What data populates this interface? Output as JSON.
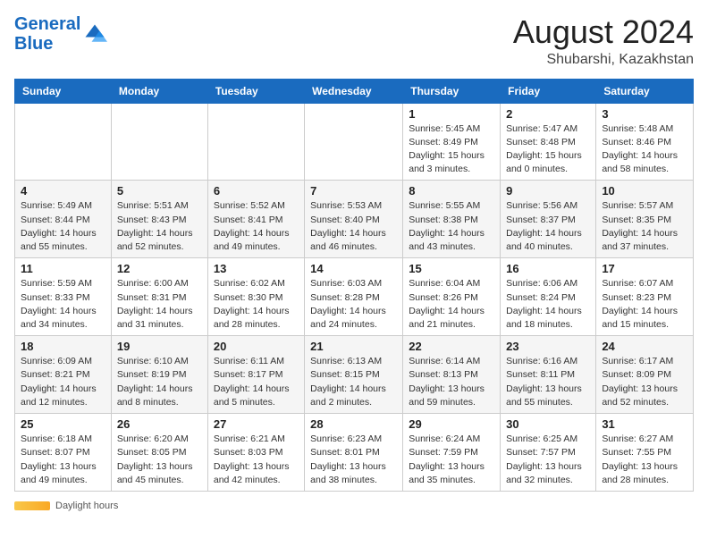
{
  "header": {
    "logo_line1": "General",
    "logo_line2": "Blue",
    "month": "August 2024",
    "location": "Shubarshi, Kazakhstan"
  },
  "days_of_week": [
    "Sunday",
    "Monday",
    "Tuesday",
    "Wednesday",
    "Thursday",
    "Friday",
    "Saturday"
  ],
  "weeks": [
    [
      {
        "day": "",
        "info": ""
      },
      {
        "day": "",
        "info": ""
      },
      {
        "day": "",
        "info": ""
      },
      {
        "day": "",
        "info": ""
      },
      {
        "day": "1",
        "info": "Sunrise: 5:45 AM\nSunset: 8:49 PM\nDaylight: 15 hours\nand 3 minutes."
      },
      {
        "day": "2",
        "info": "Sunrise: 5:47 AM\nSunset: 8:48 PM\nDaylight: 15 hours\nand 0 minutes."
      },
      {
        "day": "3",
        "info": "Sunrise: 5:48 AM\nSunset: 8:46 PM\nDaylight: 14 hours\nand 58 minutes."
      }
    ],
    [
      {
        "day": "4",
        "info": "Sunrise: 5:49 AM\nSunset: 8:44 PM\nDaylight: 14 hours\nand 55 minutes."
      },
      {
        "day": "5",
        "info": "Sunrise: 5:51 AM\nSunset: 8:43 PM\nDaylight: 14 hours\nand 52 minutes."
      },
      {
        "day": "6",
        "info": "Sunrise: 5:52 AM\nSunset: 8:41 PM\nDaylight: 14 hours\nand 49 minutes."
      },
      {
        "day": "7",
        "info": "Sunrise: 5:53 AM\nSunset: 8:40 PM\nDaylight: 14 hours\nand 46 minutes."
      },
      {
        "day": "8",
        "info": "Sunrise: 5:55 AM\nSunset: 8:38 PM\nDaylight: 14 hours\nand 43 minutes."
      },
      {
        "day": "9",
        "info": "Sunrise: 5:56 AM\nSunset: 8:37 PM\nDaylight: 14 hours\nand 40 minutes."
      },
      {
        "day": "10",
        "info": "Sunrise: 5:57 AM\nSunset: 8:35 PM\nDaylight: 14 hours\nand 37 minutes."
      }
    ],
    [
      {
        "day": "11",
        "info": "Sunrise: 5:59 AM\nSunset: 8:33 PM\nDaylight: 14 hours\nand 34 minutes."
      },
      {
        "day": "12",
        "info": "Sunrise: 6:00 AM\nSunset: 8:31 PM\nDaylight: 14 hours\nand 31 minutes."
      },
      {
        "day": "13",
        "info": "Sunrise: 6:02 AM\nSunset: 8:30 PM\nDaylight: 14 hours\nand 28 minutes."
      },
      {
        "day": "14",
        "info": "Sunrise: 6:03 AM\nSunset: 8:28 PM\nDaylight: 14 hours\nand 24 minutes."
      },
      {
        "day": "15",
        "info": "Sunrise: 6:04 AM\nSunset: 8:26 PM\nDaylight: 14 hours\nand 21 minutes."
      },
      {
        "day": "16",
        "info": "Sunrise: 6:06 AM\nSunset: 8:24 PM\nDaylight: 14 hours\nand 18 minutes."
      },
      {
        "day": "17",
        "info": "Sunrise: 6:07 AM\nSunset: 8:23 PM\nDaylight: 14 hours\nand 15 minutes."
      }
    ],
    [
      {
        "day": "18",
        "info": "Sunrise: 6:09 AM\nSunset: 8:21 PM\nDaylight: 14 hours\nand 12 minutes."
      },
      {
        "day": "19",
        "info": "Sunrise: 6:10 AM\nSunset: 8:19 PM\nDaylight: 14 hours\nand 8 minutes."
      },
      {
        "day": "20",
        "info": "Sunrise: 6:11 AM\nSunset: 8:17 PM\nDaylight: 14 hours\nand 5 minutes."
      },
      {
        "day": "21",
        "info": "Sunrise: 6:13 AM\nSunset: 8:15 PM\nDaylight: 14 hours\nand 2 minutes."
      },
      {
        "day": "22",
        "info": "Sunrise: 6:14 AM\nSunset: 8:13 PM\nDaylight: 13 hours\nand 59 minutes."
      },
      {
        "day": "23",
        "info": "Sunrise: 6:16 AM\nSunset: 8:11 PM\nDaylight: 13 hours\nand 55 minutes."
      },
      {
        "day": "24",
        "info": "Sunrise: 6:17 AM\nSunset: 8:09 PM\nDaylight: 13 hours\nand 52 minutes."
      }
    ],
    [
      {
        "day": "25",
        "info": "Sunrise: 6:18 AM\nSunset: 8:07 PM\nDaylight: 13 hours\nand 49 minutes."
      },
      {
        "day": "26",
        "info": "Sunrise: 6:20 AM\nSunset: 8:05 PM\nDaylight: 13 hours\nand 45 minutes."
      },
      {
        "day": "27",
        "info": "Sunrise: 6:21 AM\nSunset: 8:03 PM\nDaylight: 13 hours\nand 42 minutes."
      },
      {
        "day": "28",
        "info": "Sunrise: 6:23 AM\nSunset: 8:01 PM\nDaylight: 13 hours\nand 38 minutes."
      },
      {
        "day": "29",
        "info": "Sunrise: 6:24 AM\nSunset: 7:59 PM\nDaylight: 13 hours\nand 35 minutes."
      },
      {
        "day": "30",
        "info": "Sunrise: 6:25 AM\nSunset: 7:57 PM\nDaylight: 13 hours\nand 32 minutes."
      },
      {
        "day": "31",
        "info": "Sunrise: 6:27 AM\nSunset: 7:55 PM\nDaylight: 13 hours\nand 28 minutes."
      }
    ]
  ],
  "footer": {
    "daylight_label": "Daylight hours"
  }
}
